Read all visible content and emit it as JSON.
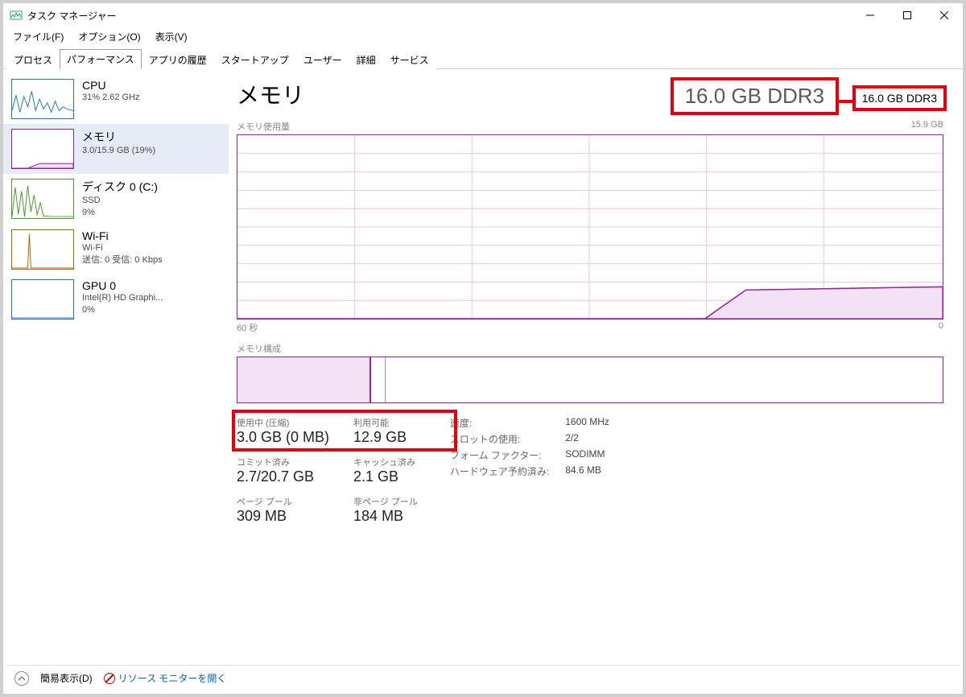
{
  "window": {
    "title": "タスク マネージャー"
  },
  "menu": {
    "file": "ファイル(F)",
    "options": "オプション(O)",
    "view": "表示(V)"
  },
  "tabs": [
    "プロセス",
    "パフォーマンス",
    "アプリの履歴",
    "スタートアップ",
    "ユーザー",
    "詳細",
    "サービス"
  ],
  "activeTabIndex": 1,
  "sidebar": [
    {
      "title": "CPU",
      "sub": "31%  2.62 GHz",
      "color": "#1f77d4"
    },
    {
      "title": "メモリ",
      "sub": "3.0/15.9 GB (19%)",
      "color": "#9b1fa3",
      "active": true
    },
    {
      "title": "ディスク 0 (C:)",
      "sub": "SSD\n9%",
      "color": "#4c9a2a"
    },
    {
      "title": "Wi-Fi",
      "sub": "Wi-Fi\n送信: 0 受信: 0 Kbps",
      "color": "#c06000"
    },
    {
      "title": "GPU 0",
      "sub": "Intel(R) HD Graphi...\n0%",
      "color": "#1f77d4"
    }
  ],
  "detail": {
    "title": "メモリ",
    "spec_highlight": "16.0 GB DDR3",
    "spec_annotation": "16.0 GB DDR3",
    "usage_label": "メモリ使用量",
    "usage_max": "15.9 GB",
    "x_left": "60 秒",
    "x_right": "0",
    "comp_label": "メモリ構成"
  },
  "stats_left": {
    "in_use_label": "使用中 (圧縮)",
    "in_use_value": "3.0 GB (0 MB)",
    "available_label": "利用可能",
    "available_value": "12.9 GB",
    "committed_label": "コミット済み",
    "committed_value": "2.7/20.7 GB",
    "cached_label": "キャッシュ済み",
    "cached_value": "2.1 GB",
    "paged_label": "ページ プール",
    "paged_value": "309 MB",
    "nonpaged_label": "非ページ プール",
    "nonpaged_value": "184 MB"
  },
  "stats_right": {
    "speed_label": "速度:",
    "speed_value": "1600 MHz",
    "slots_label": "スロットの使用:",
    "slots_value": "2/2",
    "form_label": "フォーム ファクター:",
    "form_value": "SODIMM",
    "hw_label": "ハードウェア予約済み:",
    "hw_value": "84.6 MB"
  },
  "footer": {
    "fewer": "簡易表示(D)",
    "resmon": "リソース モニターを開く"
  },
  "chart_data": {
    "type": "area",
    "title": "メモリ使用量",
    "ylabel": "GB",
    "ylim": [
      0,
      15.9
    ],
    "xlabel": "秒",
    "xlim": [
      60,
      0
    ],
    "series": [
      {
        "name": "メモリ使用量",
        "x": [
          60,
          55,
          50,
          45,
          40,
          35,
          30,
          25,
          20,
          15,
          10,
          5,
          0
        ],
        "y": [
          0,
          0,
          0,
          0,
          0,
          0,
          0,
          0,
          2.5,
          3.0,
          3.0,
          3.0,
          3.0
        ]
      }
    ],
    "composition": {
      "total_gb": 15.9,
      "in_use_gb": 3.0,
      "modified_gb": 0.2,
      "standby_gb": 2.1,
      "free_gb": 10.6
    }
  }
}
